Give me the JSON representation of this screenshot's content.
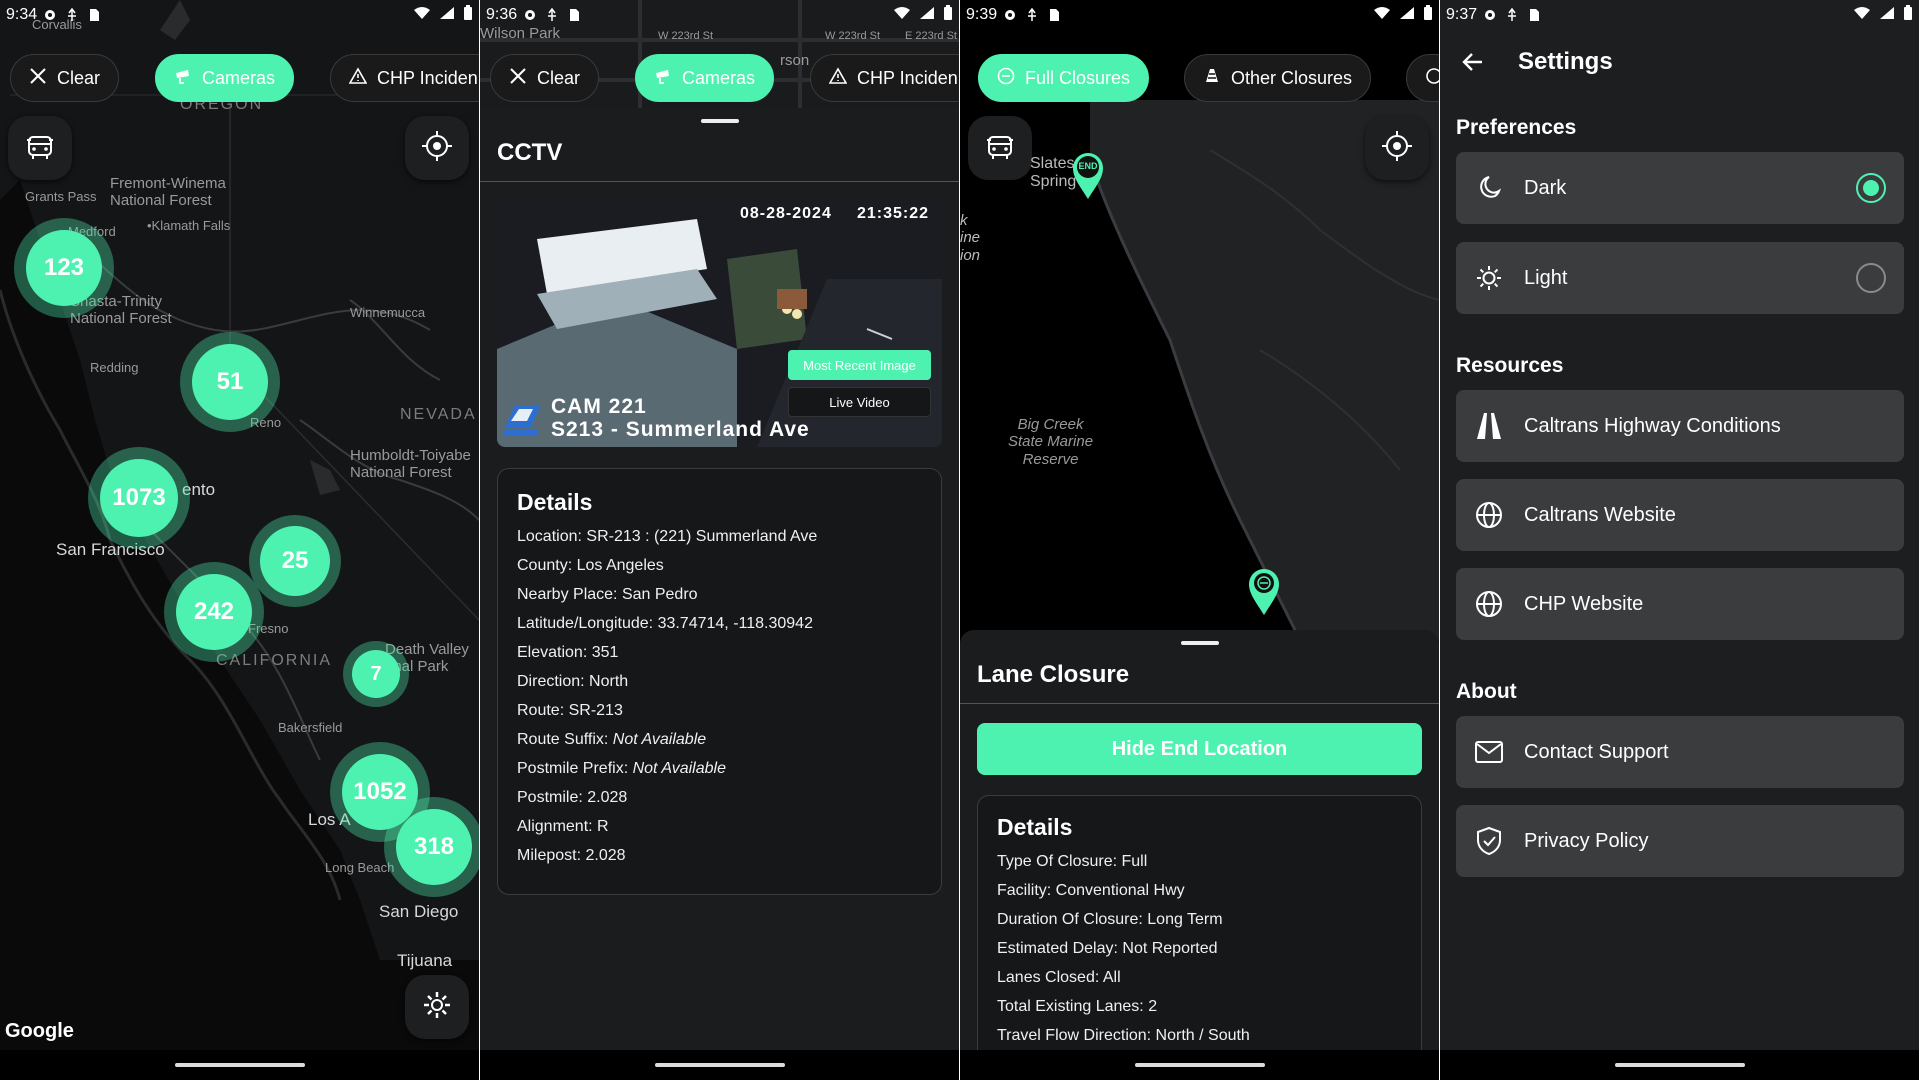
{
  "colors": {
    "accent": "#4ef2b0",
    "background": "#111214",
    "sheet": "#1b1c1e",
    "row": "#3b3c3e"
  },
  "screen1": {
    "time": "9:34",
    "chips": {
      "clear": "Clear",
      "cameras": "Cameras",
      "chp": "CHP Inciden"
    },
    "clusters": [
      "123",
      "51",
      "1073",
      "25",
      "242",
      "7",
      "1052",
      "318"
    ],
    "labels": {
      "corvallis": "Corvallis",
      "oregon": "OREGON",
      "grants_pass": "Grants Pass",
      "fremont": "Fremont-Winema\nNational Forest",
      "medford": "Medford",
      "klamath": "•Klamath Falls",
      "shasta": "Shasta-Trinity\nNational Forest",
      "redding": "Redding",
      "winnemucca": "Winnemucca",
      "nevada": "NEVADA",
      "reno": "Reno",
      "humboldt": "Humboldt-Toiyabe\nNational Forest",
      "sacramento": "ento",
      "san_francisco": "San Francisco",
      "fresno": "Fresno",
      "death_valley": "Death Valley\nonal Park",
      "california": "CALIFORNIA",
      "bakersfield": "Bakersfield",
      "los_angeles": "Los A",
      "long_beach": "Long Beach",
      "san_diego": "San Diego",
      "tijuana": "Tijuana",
      "google": "Google"
    }
  },
  "screen2": {
    "time": "9:36",
    "chips": {
      "clear": "Clear",
      "cameras": "Cameras",
      "chp": "CHP Inciden"
    },
    "map_labels": {
      "wilson": "Wilson Park",
      "w223": "W 223rd St",
      "w223b": "W 223rd St",
      "e223": "E 223rd St",
      "rson": "rson"
    },
    "title": "CCTV",
    "camera": {
      "date": "08-28-2024",
      "clock": "21:35:22",
      "cam_id": "CAM 221",
      "cam_name": "S213 - Summerland Ave",
      "most_recent": "Most Recent Image",
      "live_video": "Live Video"
    },
    "details": {
      "heading": "Details",
      "rows": [
        {
          "label": "Location: ",
          "value": "SR-213 : (221) Summerland Ave",
          "italic": false
        },
        {
          "label": "County: ",
          "value": "Los Angeles",
          "italic": false
        },
        {
          "label": "Nearby Place: ",
          "value": "San Pedro",
          "italic": false
        },
        {
          "label": "Latitude/Longitude: ",
          "value": "33.74714, -118.30942",
          "italic": false
        },
        {
          "label": "Elevation: ",
          "value": "351",
          "italic": false
        },
        {
          "label": "Direction: ",
          "value": "North",
          "italic": false
        },
        {
          "label": "Route: ",
          "value": "SR-213",
          "italic": false
        },
        {
          "label": "Route Suffix: ",
          "value": "Not Available",
          "italic": true
        },
        {
          "label": "Postmile Prefix: ",
          "value": "Not Available",
          "italic": true
        },
        {
          "label": "Postmile: ",
          "value": "2.028",
          "italic": false
        },
        {
          "label": "Alignment: ",
          "value": "R",
          "italic": false
        },
        {
          "label": "Milepost: ",
          "value": "2.028",
          "italic": false
        }
      ]
    }
  },
  "screen3": {
    "time": "9:39",
    "chips": {
      "full": "Full Closures",
      "other": "Other Closures"
    },
    "map_labels": {
      "slates": "Slates\nSpring",
      "ine": "k\nine\nion",
      "big_creek": "Big Creek\nState Marine\nReserve"
    },
    "end_marker": "END",
    "title": "Lane Closure",
    "hide_button": "Hide End Location",
    "details": {
      "heading": "Details",
      "rows": [
        "Type Of Closure: Full",
        "Facility: Conventional Hwy",
        "Duration Of Closure: Long Term",
        "Estimated Delay: Not Reported",
        "Lanes Closed: All",
        "Total Existing Lanes: 2",
        "Travel Flow Direction: North / South"
      ]
    }
  },
  "screen4": {
    "time": "9:37",
    "title": "Settings",
    "preferences": {
      "heading": "Preferences",
      "dark": "Dark",
      "light": "Light",
      "selected": "Dark"
    },
    "resources": {
      "heading": "Resources",
      "highway": "Caltrans Highway Conditions",
      "caltrans": "Caltrans Website",
      "chp": "CHP Website"
    },
    "about": {
      "heading": "About",
      "contact": "Contact Support",
      "privacy": "Privacy Policy"
    }
  }
}
